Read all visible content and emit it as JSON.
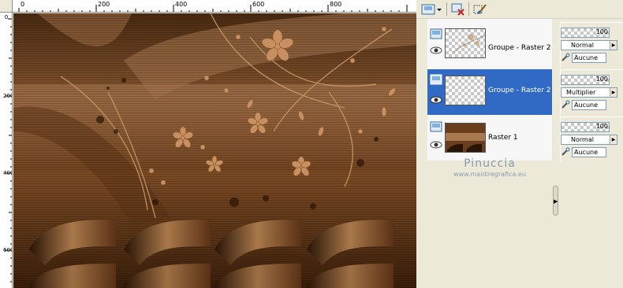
{
  "rulers": {
    "top_labels": [
      "0",
      "200",
      "400",
      "600",
      "800"
    ],
    "left_labels": [
      "0",
      "200",
      "400",
      "600"
    ]
  },
  "toolbar": {
    "new_layer_icon": "new-layer-icon",
    "delete_layer_icon": "delete-layer-icon",
    "edit_icon": "brush-icon"
  },
  "layers": [
    {
      "name": "Groupe - Raster 2",
      "thumb": "transparent-flowers",
      "selected": false,
      "opacity": "100",
      "blend": "Normal",
      "link": "Aucune"
    },
    {
      "name": "Groupe - Raster 2",
      "thumb": "transparent",
      "selected": true,
      "opacity": "100",
      "blend": "Multiplier",
      "link": "Aucune"
    },
    {
      "name": "Raster 1",
      "thumb": "brown-background",
      "selected": false,
      "opacity": "100",
      "blend": "Normal",
      "link": "Aucune"
    }
  ],
  "watermark": {
    "name": "Pinuccia",
    "url": "www.maidiregrafica.eu"
  },
  "colors": {
    "selection": "#316ac5",
    "panel_bg": "#ece9d8",
    "artwork_base": "#7a4a24"
  }
}
